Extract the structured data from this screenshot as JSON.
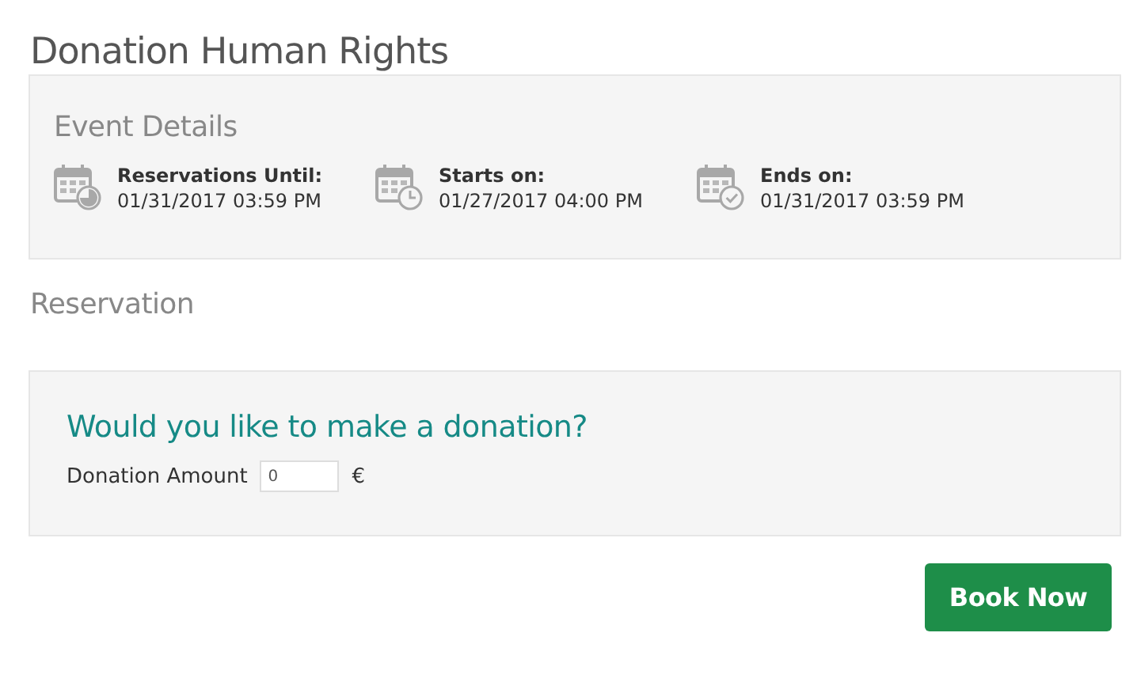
{
  "title": "Donation Human Rights",
  "event_details": {
    "heading": "Event Details",
    "items": [
      {
        "kind": "pie",
        "label": "Reservations Until:",
        "value": "01/31/2017 03:59 PM"
      },
      {
        "kind": "clock",
        "label": "Starts on:",
        "value": "01/27/2017 04:00 PM"
      },
      {
        "kind": "check",
        "label": "Ends on:",
        "value": "01/31/2017 03:59 PM"
      }
    ]
  },
  "reservation": {
    "heading": "Reservation",
    "question": "Would you like to make a donation?",
    "amount_label": "Donation Amount",
    "amount_value": "0",
    "currency": "€"
  },
  "buttons": [
    "Book Now"
  ]
}
